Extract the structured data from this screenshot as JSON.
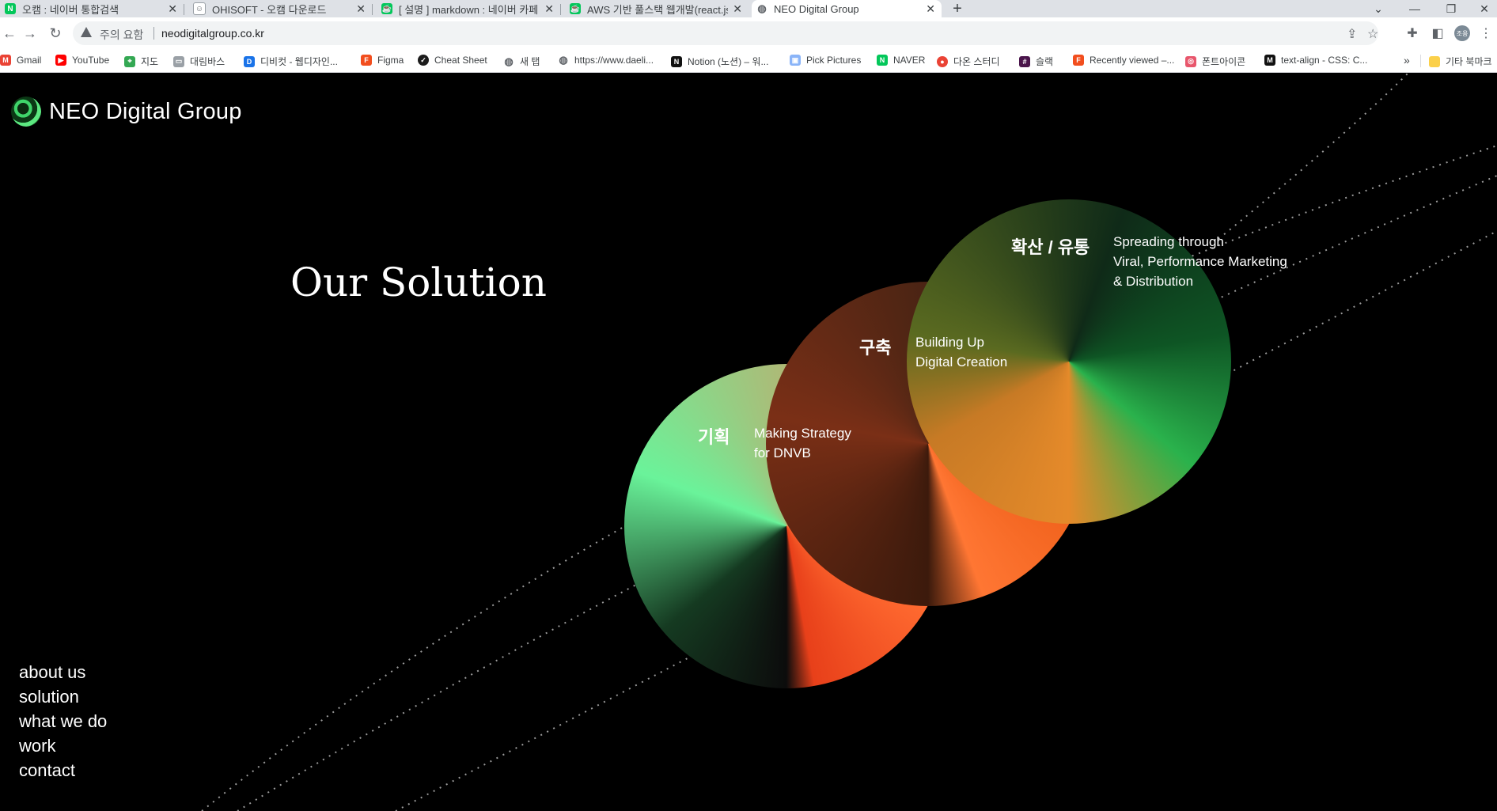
{
  "browser": {
    "tabs": [
      {
        "title": "오캠 : 네이버 통합검색",
        "icon": "naver-icon",
        "color": "#03c75a"
      },
      {
        "title": "OHISOFT - 오캠 다운로드",
        "icon": "ohisoft-icon",
        "color": "#9aa0a6"
      },
      {
        "title": "[ 설명 ] markdown : 네이버 카페",
        "icon": "cafe-icon",
        "color": "#03c75a"
      },
      {
        "title": "AWS 기반 풀스택 웹개발(react.js",
        "icon": "cafe-icon",
        "color": "#03c75a"
      },
      {
        "title": "NEO Digital Group",
        "icon": "globe-icon",
        "color": "#5f6368"
      }
    ],
    "security_label": "주의 요함",
    "url": "neodigitalgroup.co.kr",
    "avatar_label": "조용",
    "bookmarks": [
      {
        "label": "Gmail",
        "icon": "gmail-icon",
        "color": "#ea4335"
      },
      {
        "label": "YouTube",
        "icon": "youtube-icon",
        "color": "#ff0000"
      },
      {
        "label": "지도",
        "icon": "maps-icon",
        "color": "#34a853"
      },
      {
        "label": "대림바스",
        "icon": "folder-icon",
        "color": "#9aa0a6"
      },
      {
        "label": "디비컷 - 웹디자인...",
        "icon": "dbcut-icon",
        "color": "#1a73e8"
      },
      {
        "label": "Figma",
        "icon": "figma-icon",
        "color": "#f24e1e"
      },
      {
        "label": "Cheat Sheet",
        "icon": "cheatsheet-icon",
        "color": "#1c1c1c"
      },
      {
        "label": "새 탭",
        "icon": "globe-icon",
        "color": "#5f6368"
      },
      {
        "label": "https://www.daeli...",
        "icon": "globe-icon",
        "color": "#5f6368"
      },
      {
        "label": "Notion (노션) – 워...",
        "icon": "notion-icon",
        "color": "#111111"
      },
      {
        "label": "Pick Pictures",
        "icon": "image-icon",
        "color": "#8ab4f8"
      },
      {
        "label": "NAVER",
        "icon": "naver-icon",
        "color": "#03c75a"
      },
      {
        "label": "다온 스터디",
        "icon": "daon-icon",
        "color": "#ea4335"
      },
      {
        "label": "슬랙",
        "icon": "slack-icon",
        "color": "#4a154b"
      },
      {
        "label": "Recently viewed –...",
        "icon": "figma-icon",
        "color": "#f24e1e"
      },
      {
        "label": "폰트아이콘",
        "icon": "fonticon-icon",
        "color": "#e8566c"
      },
      {
        "label": "text-align - CSS: C...",
        "icon": "mdn-icon",
        "color": "#111111"
      }
    ],
    "bookmarks_more": "»",
    "other_bookmarks": "기타 북마크"
  },
  "site": {
    "logo_text": "NEO Digital Group",
    "section_title": "Our Solution",
    "solutions": [
      {
        "ko": "기획",
        "en_line1": "Making Strategy",
        "en_line2": "for DNVB"
      },
      {
        "ko": "구축",
        "en_line1": "Building Up",
        "en_line2": "Digital Creation"
      },
      {
        "ko": "확산 / 유통",
        "en_line1": "Spreading through",
        "en_line2": "Viral, Performance Marketing",
        "en_line3": "& Distribution"
      }
    ],
    "menu": [
      "about us",
      "solution",
      "what we do",
      "work",
      "contact"
    ]
  }
}
